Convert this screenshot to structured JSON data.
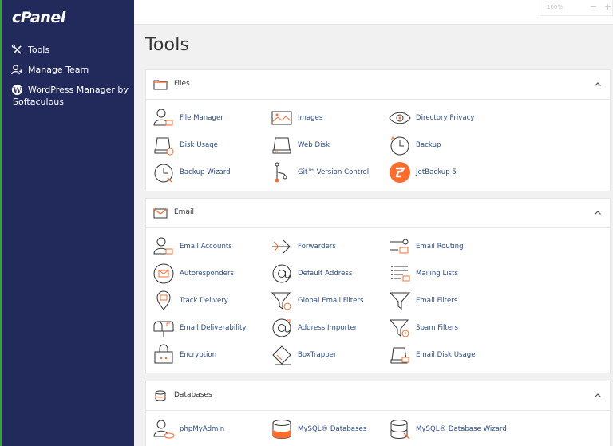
{
  "sidebar": {
    "logo": "cPanel",
    "items": [
      {
        "label": "Tools"
      },
      {
        "label": "Manage Team"
      },
      {
        "label_line1": "WordPress Manager by",
        "label_line2": "Softaculous"
      }
    ]
  },
  "topbar": {
    "zoom": "100%",
    "minus": "−",
    "plus": "+"
  },
  "page": {
    "title": "Tools"
  },
  "sections": {
    "files": {
      "title": "Files",
      "tools": [
        "File Manager",
        "Images",
        "Directory Privacy",
        "Disk Usage",
        "Web Disk",
        "Backup",
        "Backup Wizard",
        "Git™ Version Control",
        "JetBackup 5"
      ]
    },
    "email": {
      "title": "Email",
      "tools": [
        "Email Accounts",
        "Forwarders",
        "Email Routing",
        "Autoresponders",
        "Default Address",
        "Mailing Lists",
        "Track Delivery",
        "Global Email Filters",
        "Email Filters",
        "Email Deliverability",
        "Address Importer",
        "Spam Filters",
        "Encryption",
        "BoxTrapper",
        "Email Disk Usage"
      ]
    },
    "databases": {
      "title": "Databases",
      "tools": [
        "phpMyAdmin",
        "MySQL® Databases",
        "MySQL® Database Wizard"
      ]
    }
  },
  "colors": {
    "sidebar": "#222a5c",
    "accent": "#ff6c2c",
    "link": "#2a4b88"
  }
}
